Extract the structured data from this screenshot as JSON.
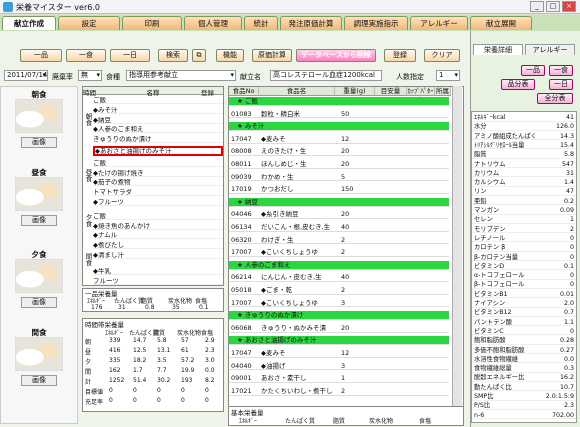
{
  "window": {
    "title": "栄養マイスター ver6.0"
  },
  "tabs": [
    "献立作成",
    "設定",
    "印刷",
    "個人管理",
    "統計",
    "発注原価計算",
    "調理実施指示",
    "アレルギー",
    "献立展開"
  ],
  "toolbar": {
    "ippin": "一品",
    "isshoku": "一食",
    "ichinichi": "一日",
    "kensaku": "検索",
    "kinou": "機能",
    "genka": "原価計算",
    "delete_db": "データベースから削除",
    "touroku": "登録",
    "clear": "クリア"
  },
  "filter": {
    "date": "2011/07/14",
    "haiki_label": "廃棄率",
    "haiki_value": "無",
    "shokushu_label": "食種",
    "shokushu_value": "指導用参考献立",
    "kondate_label": "献立名",
    "kondate_value": "高コレステロール血症1200kcal",
    "ninzu_label": "人数指定",
    "ninzu_value": "1"
  },
  "meals": [
    {
      "name": "朝食",
      "button": "画像"
    },
    {
      "name": "昼食",
      "button": "画像"
    },
    {
      "name": "夕食",
      "button": "画像"
    },
    {
      "name": "間食",
      "button": "画像"
    }
  ],
  "menu_table": {
    "headers": [
      "時間",
      "名称",
      "登録"
    ],
    "groups": [
      "朝食",
      "昼食",
      "夕食",
      "間食"
    ],
    "rows": [
      "ご飯",
      "◆みそ汁",
      "◆納豆",
      "◆人参のごま和え",
      "きゅうりのぬか漬け",
      "◆あおさと油揚げのみそ汁",
      "ご飯",
      "◆たけの揚げ焼き",
      "◆茄子の煮物",
      "トマトサラダ",
      "◆フルーツ",
      "ご飯",
      "◆焼き魚のあんかけ",
      "◆ナムル",
      "◆煮びたし",
      "◆清まし汁",
      "◆牛乳",
      "フルーツ"
    ]
  },
  "detail": {
    "headers": [
      "食品No",
      "食品名",
      "重量(g)",
      "目安量",
      "ｶｯﾌﾟﾊﾟﾀｰﾝ",
      "所属"
    ],
    "rows": [
      {
        "type": "dish",
        "name": "★ ご飯"
      },
      {
        "no": "01083",
        "name": "穀粒・精白米",
        "w": "50"
      },
      {
        "type": "dish",
        "name": "★ みそ汁"
      },
      {
        "no": "17047",
        "name": "◆麦みそ",
        "w": "12"
      },
      {
        "no": "08008",
        "name": "えのきたけ・生",
        "w": "20"
      },
      {
        "no": "08011",
        "name": "ほんしめじ・生",
        "w": "20"
      },
      {
        "no": "09039",
        "name": "わかめ・生",
        "w": "5"
      },
      {
        "no": "17019",
        "name": "かつおだし",
        "w": "150"
      },
      {
        "type": "dish",
        "name": "★ 納豆"
      },
      {
        "no": "04046",
        "name": "◆糸引き納豆",
        "w": "20"
      },
      {
        "no": "06134",
        "name": "だいこん・根,皮むき,生",
        "w": "40"
      },
      {
        "no": "06320",
        "name": "わけぎ・生",
        "w": "2"
      },
      {
        "no": "17007",
        "name": "◆こいくちしょうゆ",
        "w": "2"
      },
      {
        "type": "dish",
        "name": "★ 人参のごま和え"
      },
      {
        "no": "06214",
        "name": "にんじん・皮むき,生",
        "w": "40"
      },
      {
        "no": "05018",
        "name": "◆ごま・乾",
        "w": "2"
      },
      {
        "no": "17007",
        "name": "◆こいくちしょうゆ",
        "w": "3"
      },
      {
        "type": "dish",
        "name": "★ きゅうりのぬか漬け"
      },
      {
        "no": "06068",
        "name": "きゅうり・ぬかみそ漬",
        "w": "20"
      },
      {
        "type": "dish",
        "name": "★ あおさと油揚げのみそ汁"
      },
      {
        "no": "17047",
        "name": "◆麦みそ",
        "w": "12"
      },
      {
        "no": "04040",
        "name": "◆油揚げ",
        "w": "3"
      },
      {
        "no": "09001",
        "name": "あおさ・素干し",
        "w": "1"
      },
      {
        "no": "17021",
        "name": "かたくちいわし・煮干し",
        "w": "2"
      }
    ]
  },
  "ippin_eiyou": {
    "label": "一品栄養量",
    "headers": [
      "ｴﾈﾙｷﾞｰ",
      "たんぱく質",
      "脂質",
      "炭水化物",
      "食塩"
    ],
    "values": [
      "176",
      "31",
      "0.8",
      "35",
      "0.1"
    ]
  },
  "jikantai": {
    "label": "時間帯栄養量",
    "headers": [
      "ｴﾈﾙｷﾞｰ",
      "たんぱく質",
      "脂質",
      "炭水化物",
      "食塩"
    ],
    "rows": [
      {
        "name": "朝",
        "v": [
          "339",
          "14.7",
          "5.8",
          "57",
          "2.9"
        ]
      },
      {
        "name": "昼",
        "v": [
          "416",
          "12.5",
          "13.1",
          "61",
          "2.3"
        ]
      },
      {
        "name": "夕",
        "v": [
          "335",
          "18.2",
          "3.5",
          "57.2",
          "3.0"
        ]
      },
      {
        "name": "間",
        "v": [
          "162",
          "1.7",
          "7.7",
          "19.9",
          "0.0"
        ]
      },
      {
        "name": "計",
        "v": [
          "1252",
          "51.4",
          "30.2",
          "193",
          "8.2"
        ]
      },
      {
        "name": "目標値",
        "v": [
          "0",
          "0",
          "0",
          "0",
          "0"
        ]
      },
      {
        "name": "充足率",
        "v": [
          "0",
          "0",
          "0",
          "0",
          "0"
        ]
      }
    ]
  },
  "kihon_label": "基本栄養量",
  "kihon_headers": [
    "ｴﾈﾙｷﾞｰ",
    "たんぱく質",
    "脂質",
    "炭水化物",
    "食塩"
  ],
  "right": {
    "tabs": [
      "栄養詳細",
      "アレルギー"
    ],
    "btns": [
      "一品",
      "一食",
      "品分表",
      "一日",
      "全分表"
    ],
    "nutrients": [
      [
        "ｴﾈﾙｷﾞｰkcal",
        "41"
      ],
      [
        "水分",
        "126.0"
      ],
      [
        "アミノ酸組成たんぱく",
        "14.3"
      ],
      [
        "ﾄﾘｱｼﾙｸﾞﾘｾﾛｰﾙ当量",
        "15.4"
      ],
      [
        "脂質",
        "5.8"
      ],
      [
        "ナトリウム",
        "547"
      ],
      [
        "カリウム",
        "31"
      ],
      [
        "カルシウム",
        "1.4"
      ],
      [
        "リン",
        "47"
      ],
      [
        "亜鉛",
        "0.2"
      ],
      [
        "マンガン",
        "0.09"
      ],
      [
        "セレン",
        "1"
      ],
      [
        "モリブデン",
        "2"
      ],
      [
        "レチノール",
        "0"
      ],
      [
        "カロテン β",
        "0"
      ],
      [
        "β-カロテン当量",
        "0"
      ],
      [
        "ビタミンD",
        "0.1"
      ],
      [
        "α-トコフェロール",
        "0"
      ],
      [
        "β-トコフェロール",
        "0"
      ],
      [
        "ビタミンB1",
        "0.01"
      ],
      [
        "ナイアシン",
        "2.0"
      ],
      [
        "ビタミンB12",
        "0.7"
      ],
      [
        "パントテン酸",
        "1.1"
      ],
      [
        "ビタミンC",
        "0"
      ],
      [
        "飽和脂肪酸",
        "0.28"
      ],
      [
        "多価不飽和脂肪酸",
        "0.27"
      ],
      [
        "水溶性食物繊維",
        "0.0"
      ],
      [
        "食物繊維総量",
        "0.3"
      ],
      [
        "脱穀エネルギー比",
        "16.2"
      ],
      [
        "動たんぱく比",
        "10.7"
      ],
      [
        "SMP比",
        "2.0:1.5:9"
      ],
      [
        "P/S比",
        "2.3"
      ],
      [
        "n-6",
        "702.00"
      ]
    ]
  }
}
